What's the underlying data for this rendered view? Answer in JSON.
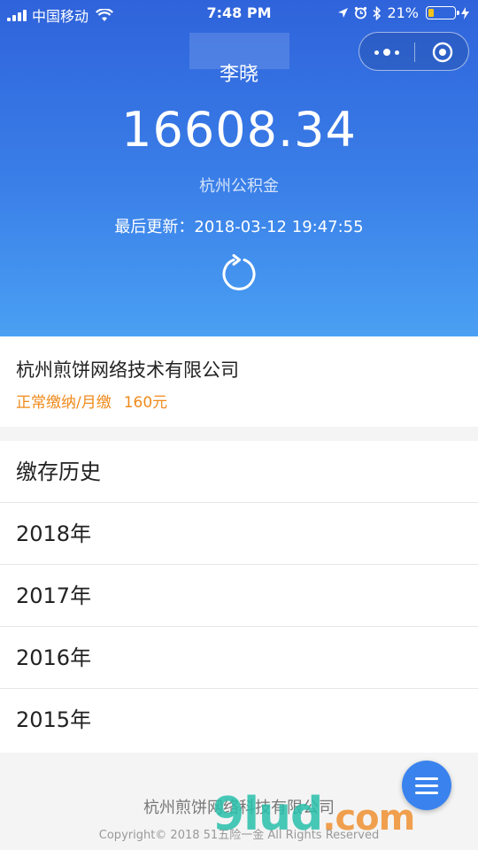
{
  "status_bar": {
    "carrier": "中国移动",
    "time": "7:48 PM",
    "battery_percent": "21%",
    "battery_level": 0.21,
    "icons": [
      "signal-icon",
      "wifi-icon",
      "location-arrow-icon",
      "alarm-icon",
      "bluetooth-icon",
      "battery-icon",
      "charging-icon"
    ]
  },
  "header": {
    "user_name": "李晓",
    "balance": "16608.34",
    "fund_label": "杭州公积金",
    "update_label": "最后更新：",
    "update_time": "2018-03-12 19:47:55",
    "refresh_icon": "refresh-icon",
    "capsule": {
      "more_icon": "more-dots-icon",
      "close_icon": "close-target-icon"
    }
  },
  "company": {
    "name": "杭州煎饼网络技术有限公司",
    "status": "正常缴纳/月缴",
    "amount": "160元"
  },
  "history": {
    "title": "缴存历史",
    "years": [
      "2018年",
      "2017年",
      "2016年",
      "2015年"
    ]
  },
  "footer": {
    "company": "杭州煎饼网络科技有限公司",
    "copyright": "Copyright© 2018 51五险一金 All Rights Reserved"
  },
  "fab": {
    "icon": "menu-icon"
  },
  "watermark": {
    "text": "9lud",
    "suffix": ".com"
  },
  "colors": {
    "header_top": "#2f63db",
    "header_bottom": "#4aa0f3",
    "accent_orange": "#f08a1c",
    "fab_blue": "#3a83ee"
  }
}
